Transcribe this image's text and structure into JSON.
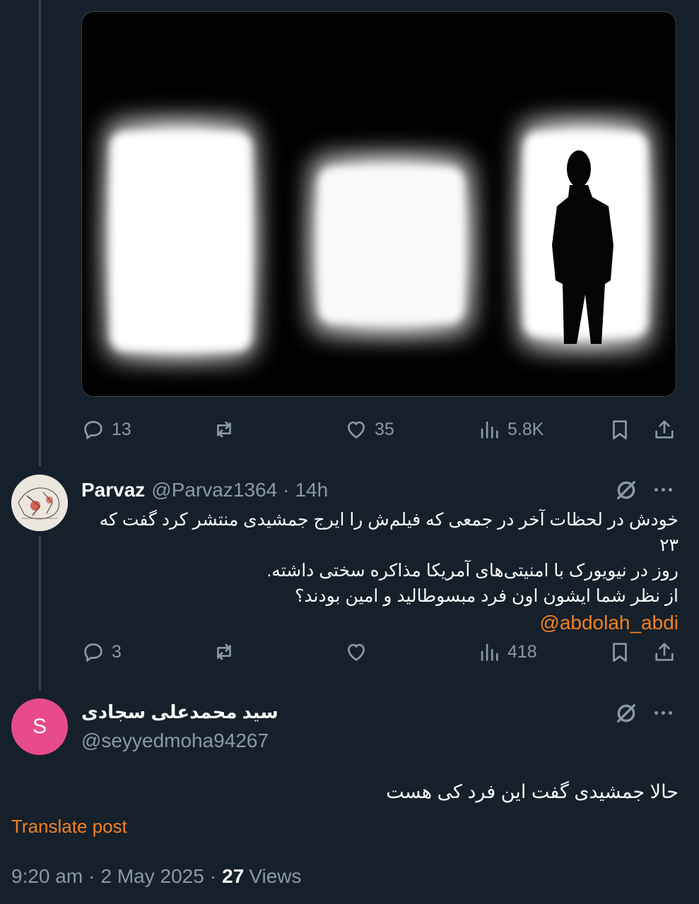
{
  "post1": {
    "replies": "13",
    "reposts": "",
    "likes": "35",
    "views": "5.8K"
  },
  "reply1": {
    "display_name": "Parvaz",
    "handle": "@Parvaz1364",
    "separator": "·",
    "time": "14h",
    "lines": [
      "خودش در لحظات آخر در جمعی که فیلم‌ش را ایرج جمشیدی منتشر کرد گفت که ۲۳",
      "روز در نیویورک با امنیتی‌های آمریکا مذاکره سختی داشته.",
      "از نظر شما ایشون اون فرد مبسوطالید و امین بودند؟"
    ],
    "mention": "@abdolah_abdi",
    "replies": "3",
    "reposts": "",
    "likes": "",
    "views": "418"
  },
  "main_post": {
    "display_name": "سید محمدعلی سجادی",
    "handle": "@seyyedmoha94267",
    "avatar_letter": "S",
    "text": "حالا جمشیدی گفت این فرد کی هست",
    "translate_label": "Translate post",
    "time": "9:20 am",
    "dot1": "·",
    "date": "2 May 2025",
    "dot2": "·",
    "views_count": "27",
    "views_label": "Views"
  },
  "colors": {
    "background": "#15202b",
    "muted": "#8b98a5",
    "accent": "#f4801f",
    "avatar_bg": "#e84b8a",
    "divider": "#38444d"
  },
  "icons": [
    "reply-icon",
    "repost-icon",
    "like-icon",
    "views-icon",
    "bookmark-icon",
    "share-icon",
    "grok-icon",
    "more-icon"
  ]
}
